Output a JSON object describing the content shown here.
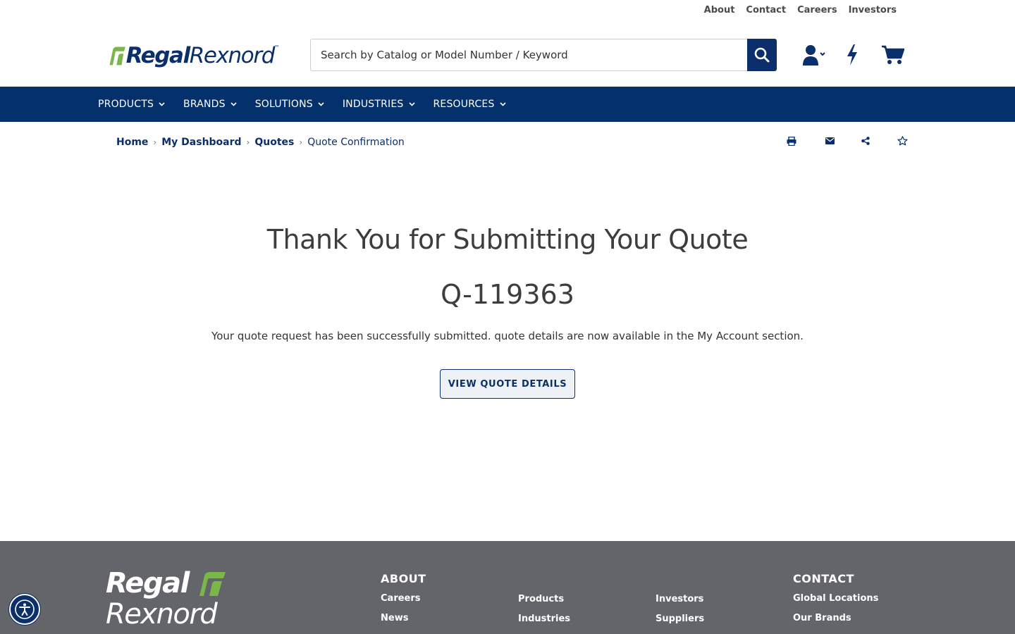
{
  "utility_links": [
    "About",
    "Contact",
    "Careers",
    "Investors"
  ],
  "logo": {
    "regal": "Regal",
    "rexnord": "Rexnord",
    "tm": "™"
  },
  "search": {
    "placeholder": "Search by Catalog or Model Number / Keyword"
  },
  "header_icons": [
    "user-icon",
    "lightning-icon",
    "cart-icon"
  ],
  "nav": [
    "PRODUCTS",
    "BRANDS",
    "SOLUTIONS",
    "INDUSTRIES",
    "RESOURCES"
  ],
  "breadcrumb": {
    "home": "Home",
    "dashboard": "My Dashboard",
    "quotes": "Quotes",
    "current": "Quote Confirmation"
  },
  "page_tools": [
    "print-icon",
    "email-icon",
    "share-icon",
    "star-icon"
  ],
  "main": {
    "title": "Thank You for Submitting Your Quote",
    "quote_id": "Q-119363",
    "message": "Your quote request has been successfully submitted. quote details are now available in the My Account section.",
    "button": "VIEW QUOTE DETAILS"
  },
  "footer": {
    "logo_l1": "Regal",
    "logo_l2": "Rexnord",
    "about_heading": "ABOUT",
    "about_links": [
      "Careers",
      "News"
    ],
    "col2_links": [
      "Products",
      "Industries"
    ],
    "col3_links": [
      "Investors",
      "Suppliers"
    ],
    "contact_heading": "CONTACT",
    "contact_links": [
      "Global Locations",
      "Our Brands"
    ]
  },
  "colors": {
    "brand_navy": "#04306b",
    "brand_green": "#7ab648",
    "footer_gray": "#63656a"
  }
}
